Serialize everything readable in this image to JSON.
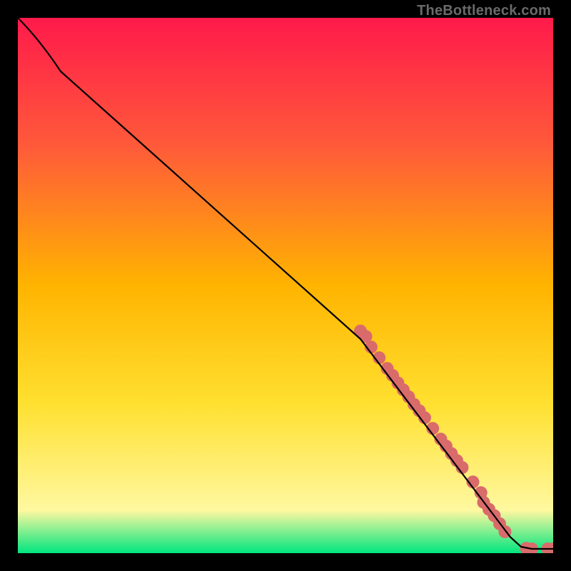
{
  "credit": "TheBottleneck.com",
  "chart_data": {
    "type": "line",
    "title": "",
    "xlabel": "",
    "ylabel": "",
    "xlim": [
      0,
      100
    ],
    "ylim": [
      0,
      100
    ],
    "grid": false,
    "legend": false,
    "background_gradient": {
      "top": "#ff1a4b",
      "q1": "#ff5a3a",
      "mid": "#ffb400",
      "q3": "#ffe030",
      "near_bottom": "#fff8a0",
      "bottom": "#00e57f"
    },
    "curve": {
      "name": "bottleneck-curve",
      "points": [
        {
          "x": 0,
          "y": 100
        },
        {
          "x": 4,
          "y": 96
        },
        {
          "x": 8,
          "y": 90
        },
        {
          "x": 64,
          "y": 40
        },
        {
          "x": 92,
          "y": 3
        },
        {
          "x": 94,
          "y": 1.2
        },
        {
          "x": 96,
          "y": 0.8
        },
        {
          "x": 100,
          "y": 0.8
        }
      ]
    },
    "markers": {
      "name": "highlighted-points",
      "color": "#d96b6b",
      "points": [
        {
          "x": 64,
          "y": 41.5
        },
        {
          "x": 65,
          "y": 40.5
        },
        {
          "x": 66,
          "y": 38.5
        },
        {
          "x": 67.5,
          "y": 36.5
        },
        {
          "x": 69,
          "y": 34.5
        },
        {
          "x": 70,
          "y": 33.2
        },
        {
          "x": 71,
          "y": 31.8
        },
        {
          "x": 72,
          "y": 30.5
        },
        {
          "x": 73,
          "y": 29.2
        },
        {
          "x": 74,
          "y": 27.8
        },
        {
          "x": 75,
          "y": 26.6
        },
        {
          "x": 76,
          "y": 25.3
        },
        {
          "x": 77.5,
          "y": 23.3
        },
        {
          "x": 79,
          "y": 21.3
        },
        {
          "x": 80,
          "y": 20.0
        },
        {
          "x": 81,
          "y": 18.6
        },
        {
          "x": 82,
          "y": 17.3
        },
        {
          "x": 83,
          "y": 16.0
        },
        {
          "x": 85,
          "y": 13.3
        },
        {
          "x": 86.5,
          "y": 11.3
        },
        {
          "x": 87,
          "y": 9.5
        },
        {
          "x": 88,
          "y": 8.2
        },
        {
          "x": 89,
          "y": 7.0
        },
        {
          "x": 90,
          "y": 5.5
        },
        {
          "x": 91,
          "y": 4.0
        },
        {
          "x": 95,
          "y": 0.9
        },
        {
          "x": 96,
          "y": 0.8
        },
        {
          "x": 99,
          "y": 0.8
        },
        {
          "x": 100,
          "y": 0.8
        }
      ]
    }
  }
}
